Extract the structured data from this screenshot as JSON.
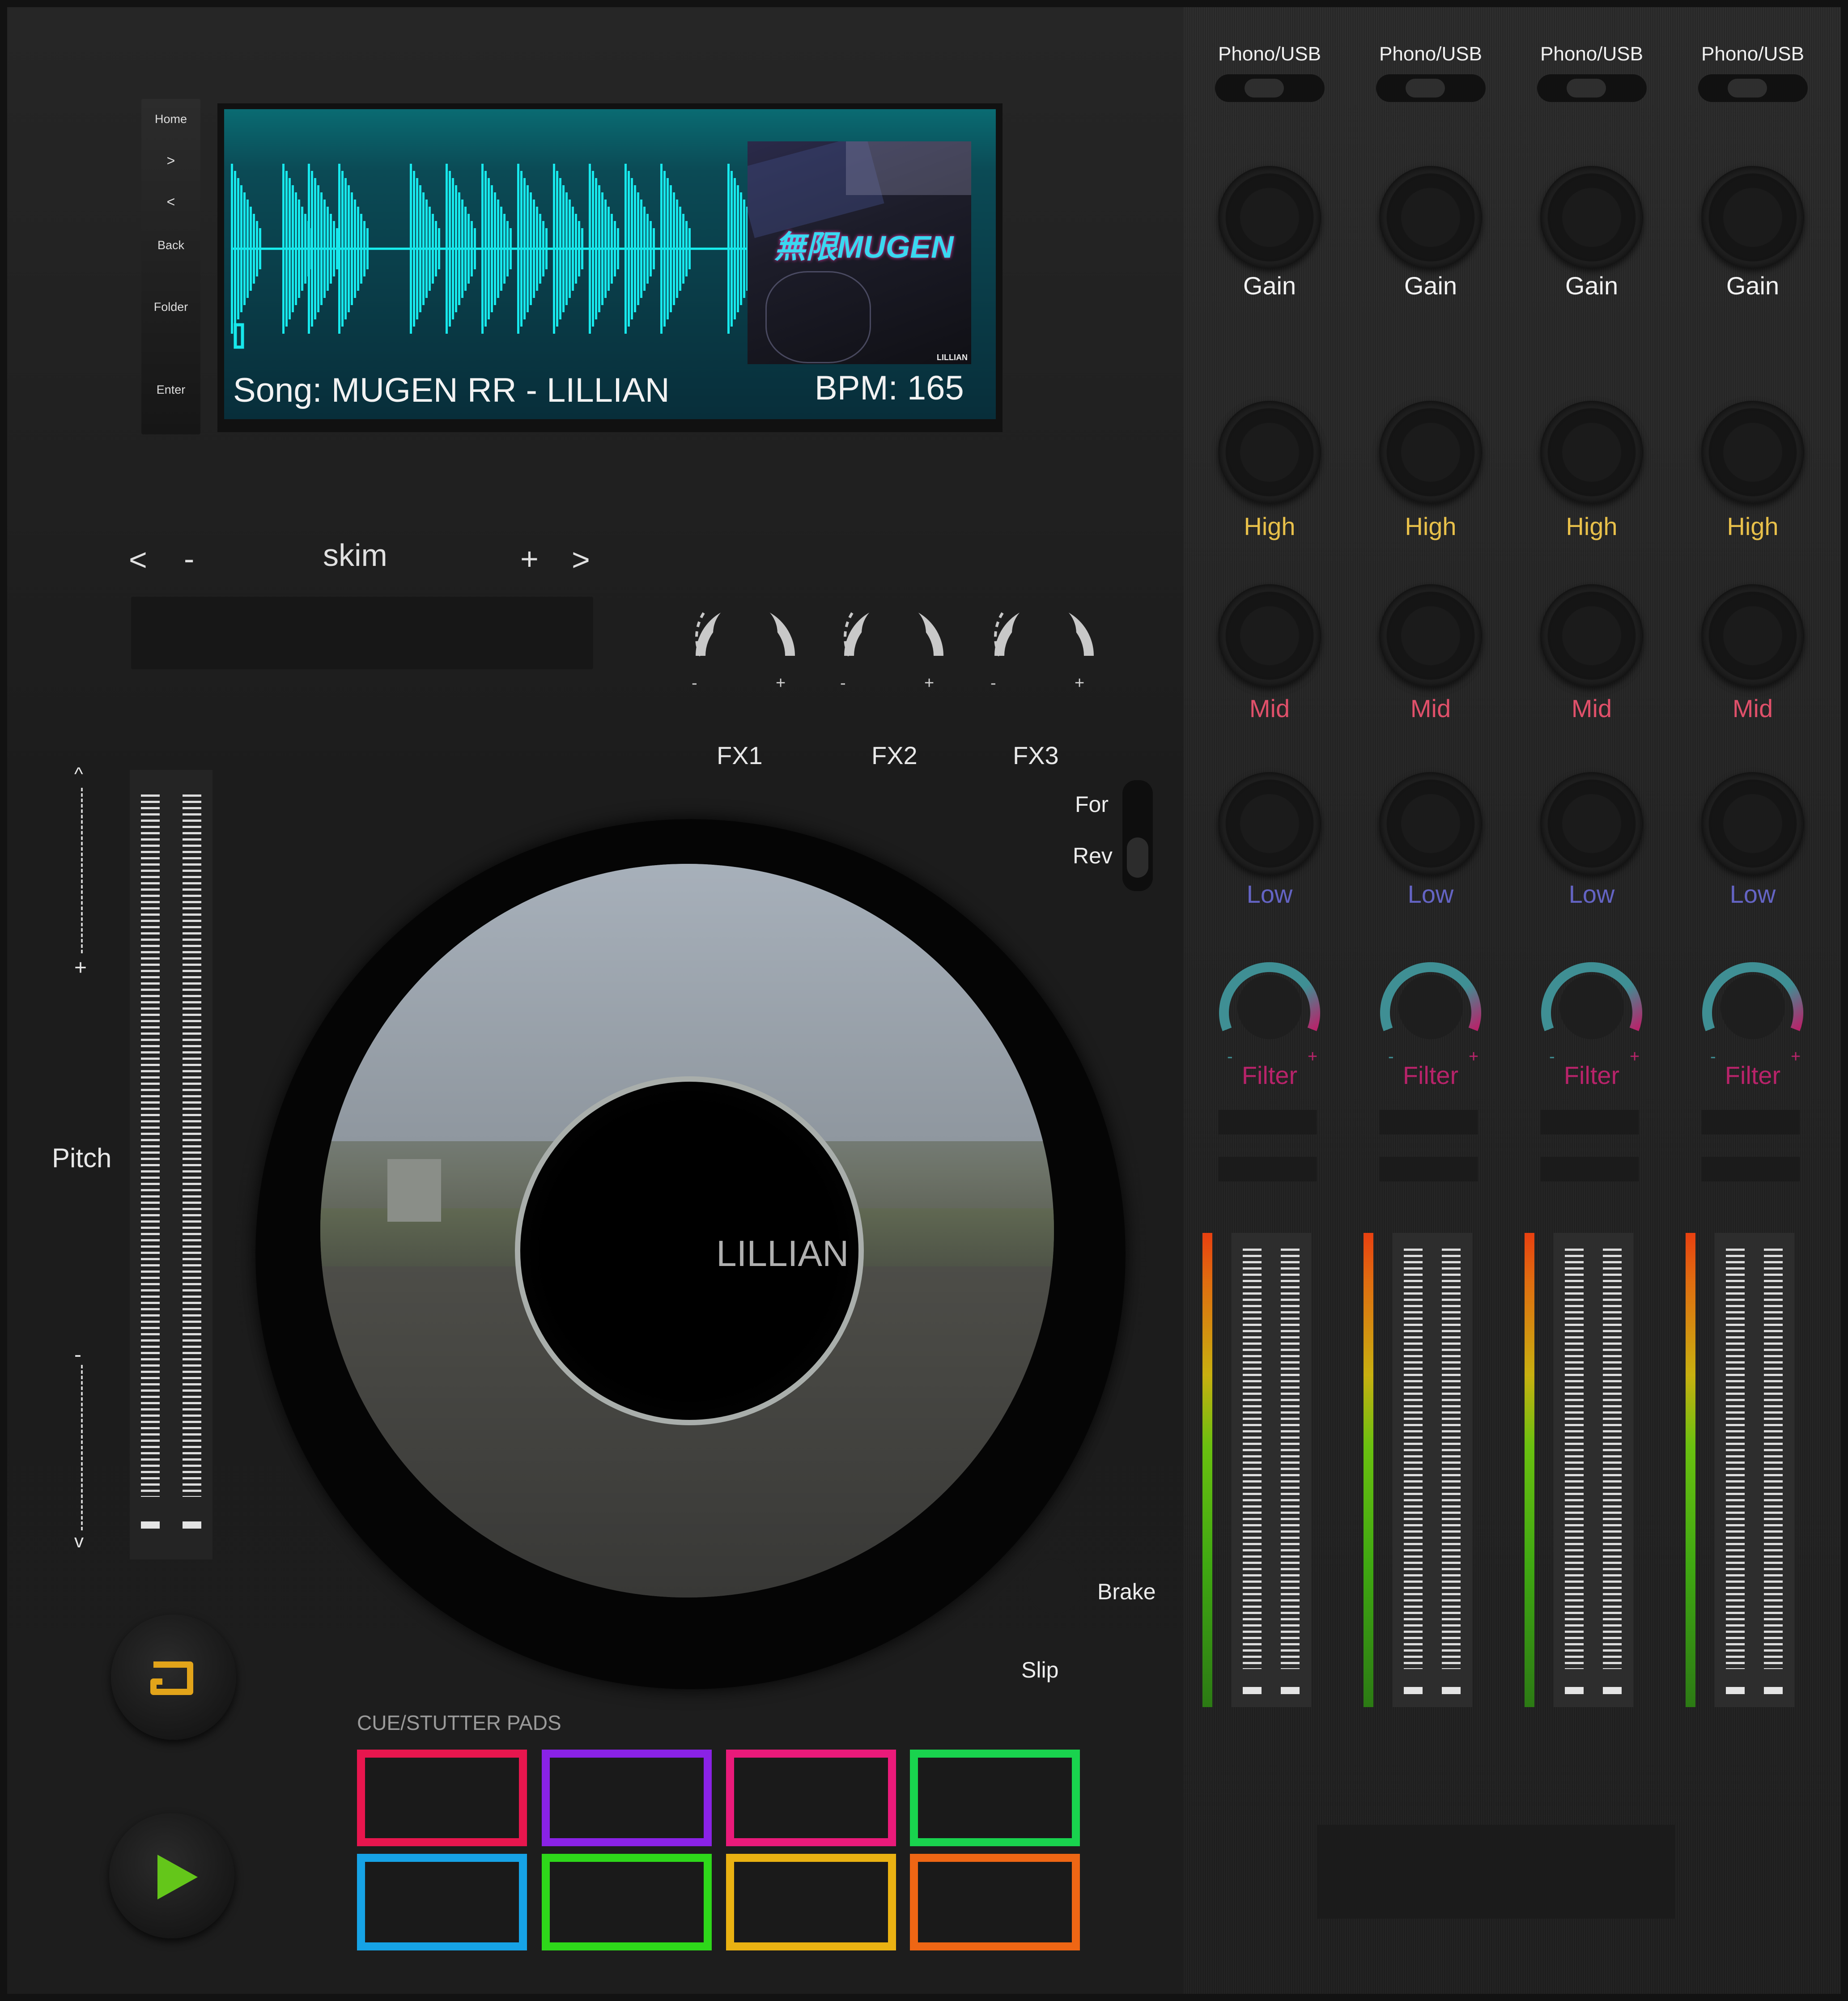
{
  "nav": {
    "home": "Home",
    "next": ">",
    "prev": "<",
    "back": "Back",
    "folder": "Folder",
    "enter": "Enter"
  },
  "display": {
    "song": "Song: MUGEN RR - LILLIAN",
    "bpm": "BPM: 165",
    "album_title": "無限MUGEN",
    "album_artist": "LILLIAN"
  },
  "skim": {
    "label": "skim",
    "prev": "<",
    "minus": "-",
    "plus": "+",
    "next": ">"
  },
  "fx": [
    {
      "label": "FX1"
    },
    {
      "label": "FX2"
    },
    {
      "label": "FX3"
    }
  ],
  "knob_signs": {
    "minus": "-",
    "plus": "+"
  },
  "direction": {
    "forward": "For",
    "reverse": "Rev"
  },
  "pitch": {
    "label": "Pitch",
    "up": "^",
    "plus": "+",
    "minus": "-",
    "down": "v"
  },
  "platter": {
    "label": "LILLIAN"
  },
  "controls": {
    "brake": "Brake",
    "slip": "Slip",
    "cue_icon": "cue-bracket-icon",
    "play_icon": "play-icon"
  },
  "pads": {
    "title": "CUE/STUTTER PADS",
    "colors": [
      "#e8164e",
      "#8a22e6",
      "#ea1a7a",
      "#19d34e",
      "#16a3e6",
      "#2ed81a",
      "#eab212",
      "#ef6614"
    ]
  },
  "mixer": {
    "channels": [
      {
        "input": "Phono/USB",
        "gain": "Gain",
        "high": "High",
        "mid": "Mid",
        "low": "Low",
        "filter": "Filter"
      },
      {
        "input": "Phono/USB",
        "gain": "Gain",
        "high": "High",
        "mid": "Mid",
        "low": "Low",
        "filter": "Filter"
      },
      {
        "input": "Phono/USB",
        "gain": "Gain",
        "high": "High",
        "mid": "Mid",
        "low": "Low",
        "filter": "Filter"
      },
      {
        "input": "Phono/USB",
        "gain": "Gain",
        "high": "High",
        "mid": "Mid",
        "low": "Low",
        "filter": "Filter"
      }
    ],
    "colors": {
      "high": "#e8c04a",
      "mid": "#e0506a",
      "low": "#6464c4",
      "filter": "#b8236a",
      "teal": "#3f8f94"
    }
  }
}
